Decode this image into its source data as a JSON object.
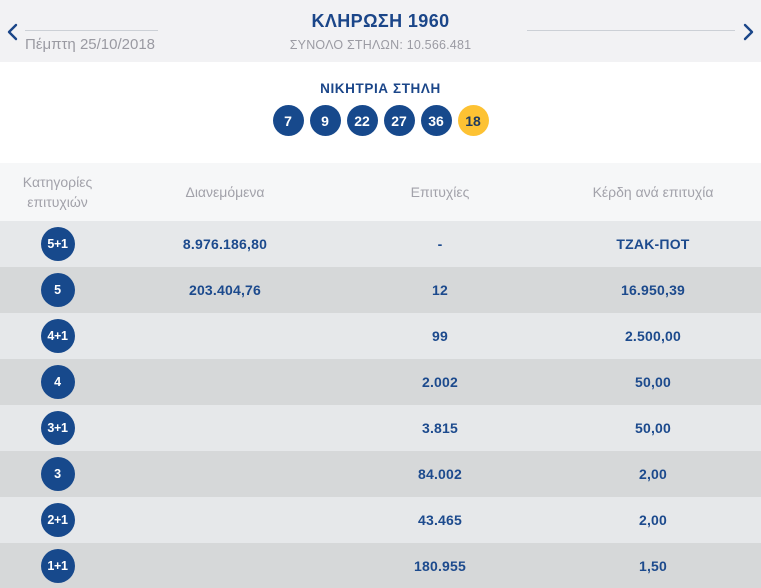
{
  "header": {
    "title": "ΚΛΗΡΩΣΗ 1960",
    "subtitle_label": "ΣΥΝΟΛΟ ΣΤΗΛΩΝ:",
    "subtitle_value": "10.566.481",
    "date": "Πέμπτη 25/10/2018",
    "prev_icon": "chevron-left",
    "next_icon": "chevron-right"
  },
  "winning": {
    "title": "ΝΙΚΗΤΡΙΑ ΣΤΗΛΗ",
    "numbers": [
      "7",
      "9",
      "22",
      "27",
      "36"
    ],
    "joker": "18"
  },
  "table": {
    "columns": [
      "Κατηγορίες επιτυχιών",
      "Διανεμόμενα",
      "Επιτυχίες",
      "Κέρδη ανά επιτυχία"
    ],
    "rows": [
      {
        "category": "5+1",
        "distributed": "8.976.186,80",
        "winners": "-",
        "prize": "ΤΖΑΚ-ΠΟΤ"
      },
      {
        "category": "5",
        "distributed": "203.404,76",
        "winners": "12",
        "prize": "16.950,39"
      },
      {
        "category": "4+1",
        "distributed": "",
        "winners": "99",
        "prize": "2.500,00"
      },
      {
        "category": "4",
        "distributed": "",
        "winners": "2.002",
        "prize": "50,00"
      },
      {
        "category": "3+1",
        "distributed": "",
        "winners": "3.815",
        "prize": "50,00"
      },
      {
        "category": "3",
        "distributed": "",
        "winners": "84.002",
        "prize": "2,00"
      },
      {
        "category": "2+1",
        "distributed": "",
        "winners": "43.465",
        "prize": "2,00"
      },
      {
        "category": "1+1",
        "distributed": "",
        "winners": "180.955",
        "prize": "1,50"
      }
    ]
  },
  "colors": {
    "accent_blue": "#1b4689",
    "ball_blue": "#17498c",
    "joker_yellow": "#fdc233",
    "joker_text": "#1e3a5f",
    "row_light": "#e6e8ea",
    "row_dark": "#d6d8d9",
    "header_bg": "#f2f2f4",
    "table_header_bg": "#f6f7f8",
    "muted_text": "#9b9ba3"
  }
}
